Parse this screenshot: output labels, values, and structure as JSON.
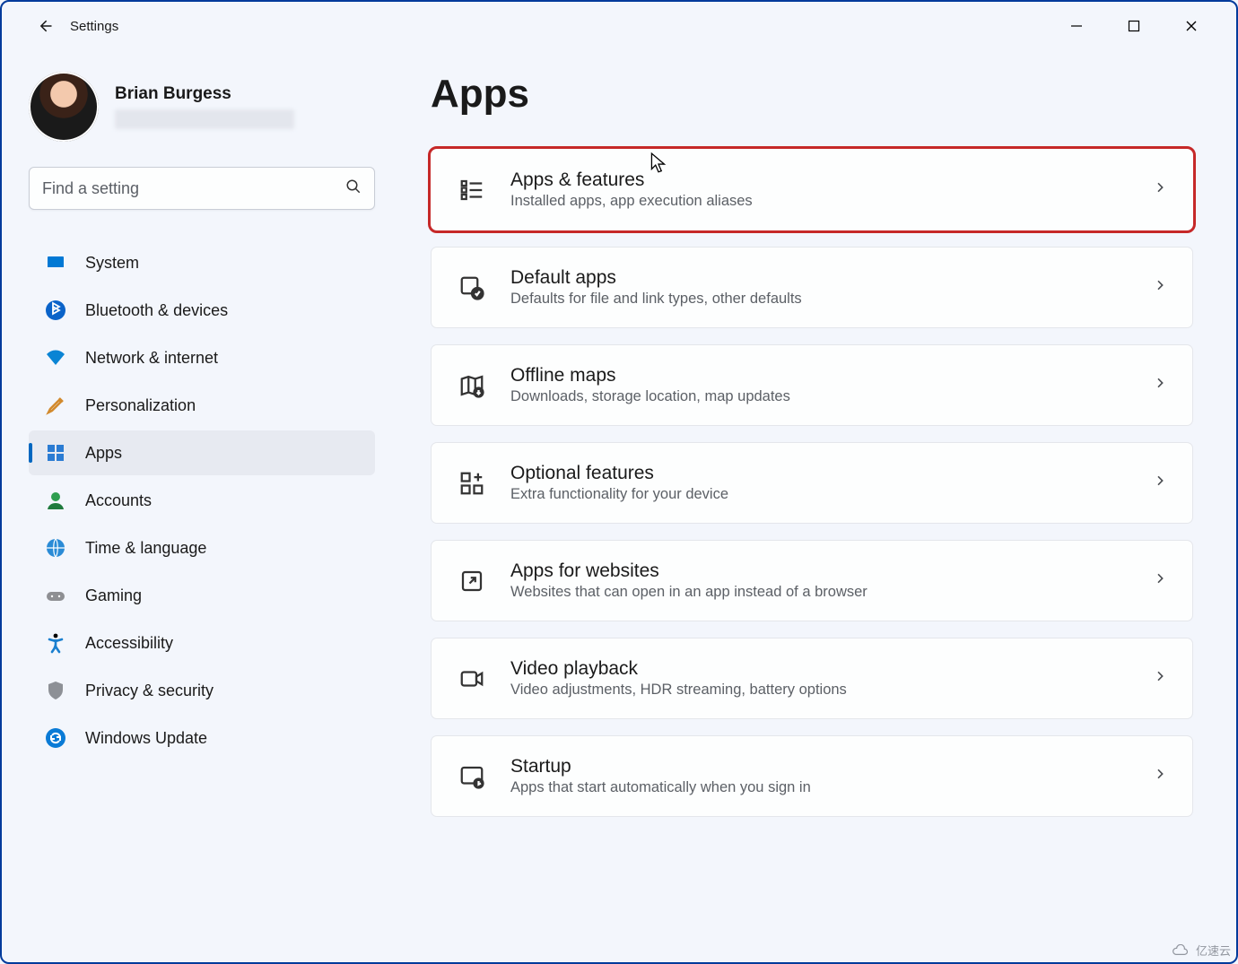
{
  "window": {
    "app_title": "Settings"
  },
  "profile": {
    "name": "Brian Burgess"
  },
  "search": {
    "placeholder": "Find a setting",
    "value": ""
  },
  "sidebar": {
    "items": [
      {
        "id": "system",
        "label": "System",
        "icon": "monitor-icon",
        "active": false
      },
      {
        "id": "bluetooth",
        "label": "Bluetooth & devices",
        "icon": "bluetooth-icon",
        "active": false
      },
      {
        "id": "network",
        "label": "Network & internet",
        "icon": "wifi-icon",
        "active": false
      },
      {
        "id": "personalization",
        "label": "Personalization",
        "icon": "paintbrush-icon",
        "active": false
      },
      {
        "id": "apps",
        "label": "Apps",
        "icon": "apps-icon",
        "active": true
      },
      {
        "id": "accounts",
        "label": "Accounts",
        "icon": "person-icon",
        "active": false
      },
      {
        "id": "time",
        "label": "Time & language",
        "icon": "clock-globe-icon",
        "active": false
      },
      {
        "id": "gaming",
        "label": "Gaming",
        "icon": "gamepad-icon",
        "active": false
      },
      {
        "id": "accessibility",
        "label": "Accessibility",
        "icon": "accessibility-icon",
        "active": false
      },
      {
        "id": "privacy",
        "label": "Privacy & security",
        "icon": "shield-icon",
        "active": false
      },
      {
        "id": "update",
        "label": "Windows Update",
        "icon": "update-icon",
        "active": false
      }
    ]
  },
  "page": {
    "title": "Apps",
    "cards": [
      {
        "id": "apps-features",
        "title": "Apps & features",
        "subtitle": "Installed apps, app execution aliases",
        "icon": "list-grid-icon",
        "highlight": true
      },
      {
        "id": "default-apps",
        "title": "Default apps",
        "subtitle": "Defaults for file and link types, other defaults",
        "icon": "default-check-icon",
        "highlight": false
      },
      {
        "id": "offline-maps",
        "title": "Offline maps",
        "subtitle": "Downloads, storage location, map updates",
        "icon": "map-download-icon",
        "highlight": false
      },
      {
        "id": "optional",
        "title": "Optional features",
        "subtitle": "Extra functionality for your device",
        "icon": "grid-plus-icon",
        "highlight": false
      },
      {
        "id": "websites",
        "title": "Apps for websites",
        "subtitle": "Websites that can open in an app instead of a browser",
        "icon": "open-external-icon",
        "highlight": false
      },
      {
        "id": "video",
        "title": "Video playback",
        "subtitle": "Video adjustments, HDR streaming, battery options",
        "icon": "video-icon",
        "highlight": false
      },
      {
        "id": "startup",
        "title": "Startup",
        "subtitle": "Apps that start automatically when you sign in",
        "icon": "startup-icon",
        "highlight": false
      }
    ]
  },
  "watermark": "亿速云"
}
